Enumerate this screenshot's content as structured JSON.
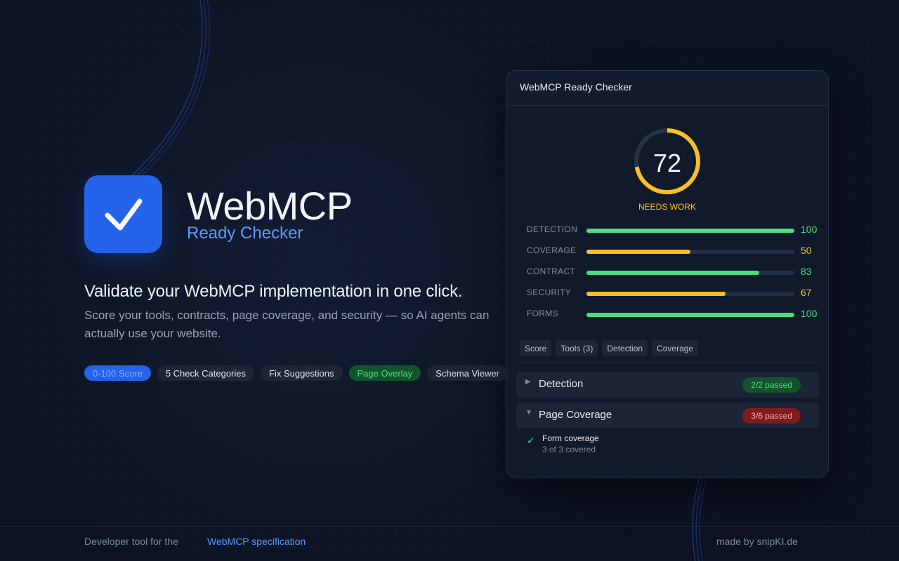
{
  "hero": {
    "logo_icon": "checkmark-icon",
    "brand_title": "WebMCP",
    "brand_subtitle": "Ready Checker",
    "headline": "Validate your WebMCP implementation in one click.",
    "description": "Score your tools, contracts, page coverage, and security — so AI agents can actually use your website.",
    "pills": [
      {
        "label": "0-100 Score",
        "variant": "blue"
      },
      {
        "label": "5 Check Categories",
        "variant": "neutral"
      },
      {
        "label": "Fix Suggestions",
        "variant": "neutral"
      },
      {
        "label": "Page Overlay",
        "variant": "green"
      },
      {
        "label": "Schema Viewer",
        "variant": "neutral"
      }
    ]
  },
  "card": {
    "title": "WebMCP Ready Checker",
    "score": {
      "value": "72",
      "max": 100,
      "status": "NEEDS WORK",
      "color": "#fbbf24"
    },
    "metrics": [
      {
        "label": "DETECTION",
        "value": "100",
        "color": "#4ade80"
      },
      {
        "label": "COVERAGE",
        "value": "50",
        "color": "#fbbf24"
      },
      {
        "label": "CONTRACT",
        "value": "83",
        "color": "#4ade80"
      },
      {
        "label": "SECURITY",
        "value": "67",
        "color": "#fbbf24"
      },
      {
        "label": "FORMS",
        "value": "100",
        "color": "#4ade80"
      }
    ],
    "tabs": [
      "Score",
      "Tools (3)",
      "Detection",
      "Coverage"
    ],
    "sections": [
      {
        "title": "Detection",
        "badge": "2/2 passed",
        "status": "pass",
        "expanded": false
      },
      {
        "title": "Page Coverage",
        "badge": "3/6 passed",
        "status": "fail",
        "expanded": true
      }
    ],
    "check_item": {
      "icon": "check-icon",
      "title": "Form coverage",
      "detail": "3 of 3 covered"
    }
  },
  "footer": {
    "lead": "Developer tool for the",
    "link_label": "WebMCP specification",
    "credit": "made by snipKI.de"
  },
  "colors": {
    "accent": "#2563eb",
    "pass": "#4ade80",
    "warn": "#fbbf24",
    "fail": "#fca5a5"
  }
}
